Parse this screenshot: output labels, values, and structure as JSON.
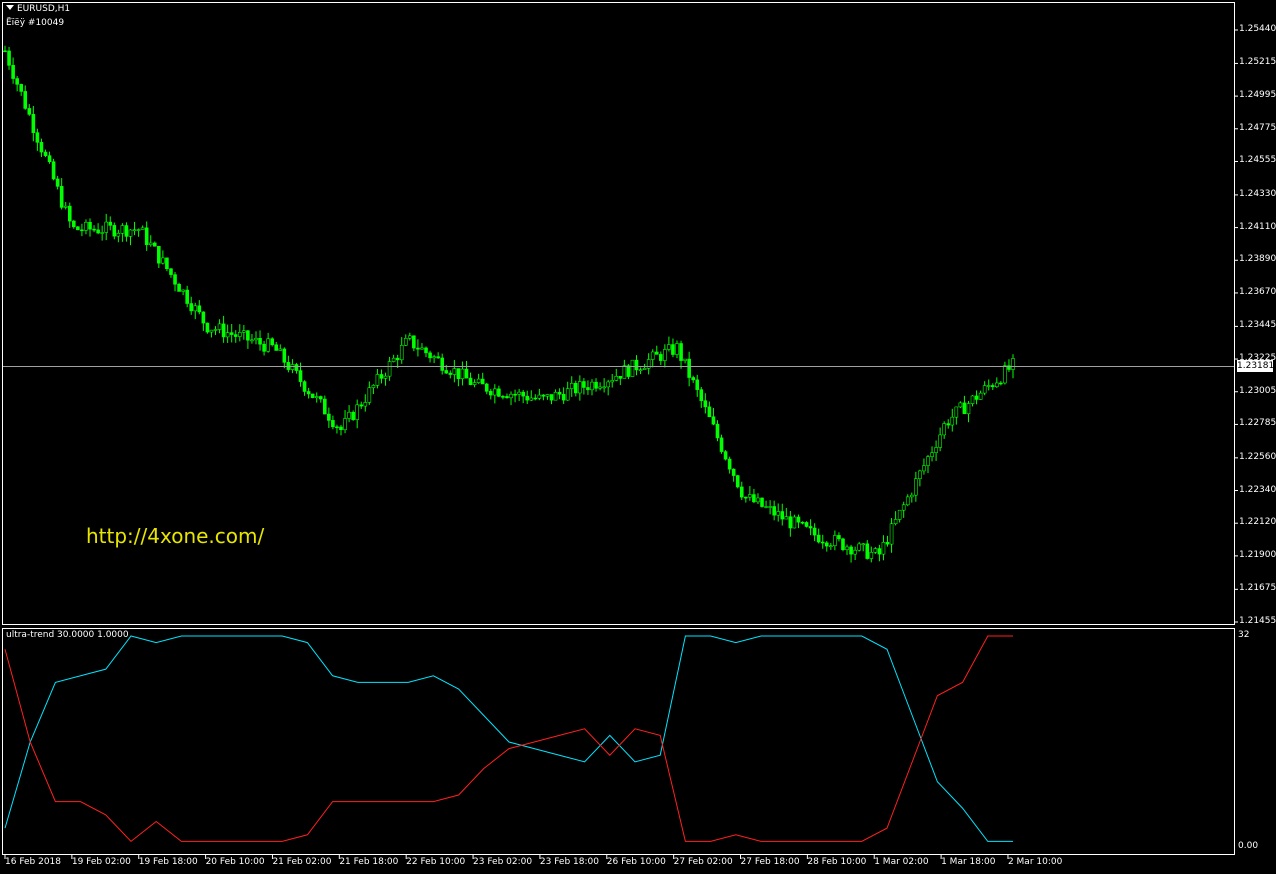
{
  "main_window": {
    "symbol_label": "EURUSD,H1",
    "expert_label": "Ëïëÿ #10049",
    "watermark": "http://4xone.com/",
    "current_price": "1.23181",
    "price_ticks": [
      "1.25440",
      "1.25215",
      "1.24995",
      "1.24775",
      "1.24555",
      "1.24330",
      "1.24110",
      "1.23890",
      "1.23670",
      "1.23445",
      "1.23225",
      "1.23005",
      "1.22785",
      "1.22560",
      "1.22340",
      "1.22120",
      "1.21900",
      "1.21675",
      "1.21455"
    ]
  },
  "indicator_window": {
    "label": "ultra-trend 30.0000 1.0000",
    "top_tick": "32",
    "bottom_tick": "0.00"
  },
  "time_axis": [
    "16 Feb 2018",
    "19 Feb 02:00",
    "19 Feb 18:00",
    "20 Feb 10:00",
    "21 Feb 02:00",
    "21 Feb 18:00",
    "22 Feb 10:00",
    "23 Feb 02:00",
    "23 Feb 18:00",
    "26 Feb 10:00",
    "27 Feb 02:00",
    "27 Feb 18:00",
    "28 Feb 10:00",
    "1 Mar 02:00",
    "1 Mar 18:00",
    "2 Mar 10:00"
  ],
  "colors": {
    "background": "#000000",
    "candles": "#00ff00",
    "grid_frame": "#ffffff",
    "price_line": "#a0a0a0",
    "ultra_up": "#00e5ff",
    "ultra_down": "#ff2020",
    "watermark": "#e6e600"
  },
  "chart_data": [
    {
      "type": "candlestick",
      "title": "EURUSD,H1",
      "ylim": [
        1.21455,
        1.2544
      ],
      "x_labels": [
        "16 Feb 2018",
        "19 Feb 02:00",
        "19 Feb 18:00",
        "20 Feb 10:00",
        "21 Feb 02:00",
        "21 Feb 18:00",
        "22 Feb 10:00",
        "23 Feb 02:00",
        "23 Feb 18:00",
        "26 Feb 10:00",
        "27 Feb 02:00",
        "27 Feb 18:00",
        "28 Feb 10:00",
        "1 Mar 02:00",
        "1 Mar 18:00",
        "2 Mar 10:00"
      ],
      "close_path_keypoints": [
        {
          "x": "16 Feb 2018",
          "y": 1.253
        },
        {
          "x": "19 Feb 02:00",
          "y": 1.241
        },
        {
          "x": "19 Feb 18:00",
          "y": 1.241
        },
        {
          "x": "20 Feb 10:00",
          "y": 1.2345
        },
        {
          "x": "21 Feb 02:00",
          "y": 1.233
        },
        {
          "x": "21 Feb 18:00",
          "y": 1.2275
        },
        {
          "x": "22 Feb 10:00",
          "y": 1.2335
        },
        {
          "x": "23 Feb 02:00",
          "y": 1.2305
        },
        {
          "x": "23 Feb 18:00",
          "y": 1.2295
        },
        {
          "x": "26 Feb 10:00",
          "y": 1.231
        },
        {
          "x": "27 Feb 02:00",
          "y": 1.233
        },
        {
          "x": "27 Feb 18:00",
          "y": 1.223
        },
        {
          "x": "28 Feb 10:00",
          "y": 1.2205
        },
        {
          "x": "1 Mar 02:00",
          "y": 1.219
        },
        {
          "x": "1 Mar 18:00",
          "y": 1.228
        },
        {
          "x": "2 Mar 10:00",
          "y": 1.2318
        }
      ],
      "last_price": 1.23181
    },
    {
      "type": "line",
      "title": "ultra-trend 30.0000 1.0000",
      "ylim": [
        0,
        32
      ],
      "series": [
        {
          "values": [
            3,
            16,
            25,
            26,
            27,
            32,
            31,
            32,
            32,
            32,
            32,
            32,
            31,
            26,
            25,
            25,
            25,
            26,
            24,
            20,
            16,
            15,
            14,
            13,
            17,
            13,
            14,
            32,
            32,
            31,
            32,
            32,
            32,
            32,
            32,
            30,
            20,
            10,
            6,
            1,
            1
          ]
        },
        {
          "values": [
            30,
            16,
            7,
            7,
            5,
            1,
            4,
            1,
            1,
            1,
            1,
            1,
            2,
            7,
            7,
            7,
            7,
            7,
            8,
            12,
            15,
            16,
            17,
            18,
            14,
            18,
            17,
            1,
            1,
            2,
            1,
            1,
            1,
            1,
            1,
            3,
            13,
            23,
            25,
            32,
            32
          ]
        }
      ]
    }
  ]
}
